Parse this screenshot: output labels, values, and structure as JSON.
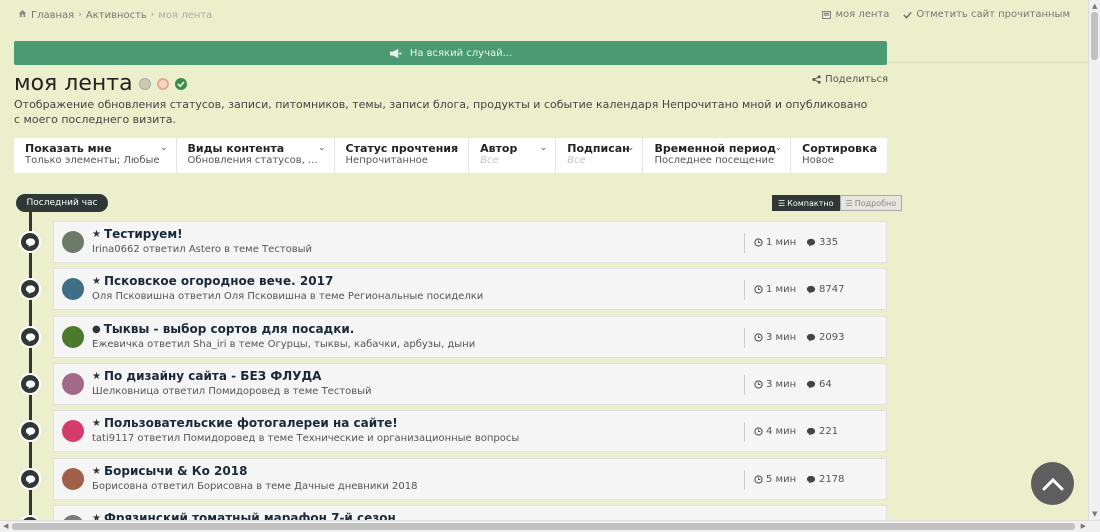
{
  "breadcrumb": {
    "items": [
      "Главная",
      "Активность"
    ],
    "current": "моя лента"
  },
  "top_actions": {
    "feed": "моя лента",
    "mark_read": "Отметить сайт прочитанным"
  },
  "banner": {
    "text": "На всякий случай..."
  },
  "page": {
    "title": "моя лента",
    "share": "Поделиться",
    "description": "Отображение обновления статусов, записи, питомников, темы, записи блога, продукты и событие календаря Непрочитано мной и опубликовано с моего последнего визита."
  },
  "filters": [
    {
      "label": "Показать мне",
      "value": "Только элементы; Любые"
    },
    {
      "label": "Виды контента",
      "value": "Обновления статусов, ..."
    },
    {
      "label": "Статус прочтения",
      "value": "Непрочитанное"
    },
    {
      "label": "Автор",
      "value": "Все"
    },
    {
      "label": "Подписан",
      "value": "Все"
    },
    {
      "label": "Временной период",
      "value": "Последнее посещение"
    },
    {
      "label": "Сортировка",
      "value": "Новое"
    }
  ],
  "timeline": {
    "label": "Последний час"
  },
  "view": {
    "compact": "Компактно",
    "detailed": "Подробно"
  },
  "items": [
    {
      "title": "Тестируем!",
      "sub": "Irina0662 ответил Astero в теме Тестовый",
      "time": "1 мин",
      "count": "335",
      "mark": "star",
      "avatar": "#6e7a68"
    },
    {
      "title": "Псковское огородное вече. 2017",
      "sub": "Оля Псковишна ответил Оля Псковишна в теме Региональные посиделки",
      "time": "1 мин",
      "count": "8747",
      "mark": "star",
      "avatar": "#3f6f86"
    },
    {
      "title": "Тыквы - выбор сортов для посадки.",
      "sub": "Ежевичка ответил Sha_iri в теме Огурцы, тыквы, кабачки, арбузы, дыни",
      "time": "3 мин",
      "count": "2093",
      "mark": "dot",
      "avatar": "#4b7a2e"
    },
    {
      "title": "По дизайну сайта - БЕЗ ФЛУДА",
      "sub": "Шелковница ответил Помидоровед в теме Тестовый",
      "time": "3 мин",
      "count": "64",
      "mark": "star",
      "avatar": "#a26a88"
    },
    {
      "title": "Пользовательские фотогалереи на сайте!",
      "sub": "tati9117 ответил Помидоровед в теме Технические и организационные вопросы",
      "time": "4 мин",
      "count": "221",
      "mark": "star",
      "avatar": "#d43c6e"
    },
    {
      "title": "Борисычи & Ко 2018",
      "sub": "Борисовна ответил Борисовна в теме Дачные дневники 2018",
      "time": "5 мин",
      "count": "2178",
      "mark": "star",
      "avatar": "#a0604a"
    },
    {
      "title": "Фрязинский томатный марафон 7-й сезон",
      "sub": "",
      "time": "",
      "count": "",
      "mark": "star",
      "avatar": "#7a7a7a"
    }
  ],
  "icons": {
    "home": "home-icon",
    "chevron": "chevron-right-icon",
    "feed": "feed-icon",
    "check": "check-icon",
    "megaphone": "megaphone-icon",
    "share": "share-icon",
    "clock": "clock-icon",
    "comment": "comment-icon",
    "star": "star-icon",
    "scroll_top": "chevron-up-icon"
  }
}
